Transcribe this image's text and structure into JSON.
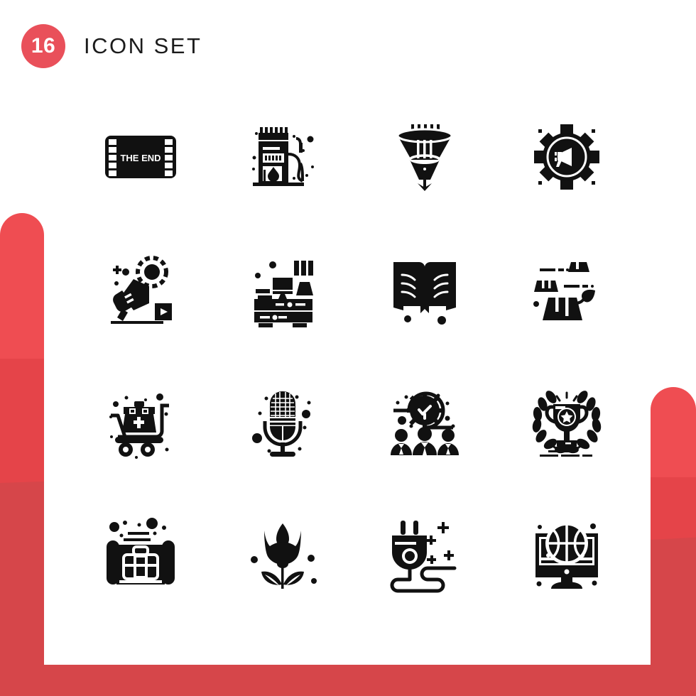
{
  "header": {
    "count": "16",
    "title": "Icon Set",
    "badge_color": "#e9505a",
    "title_color": "#1b1b1b"
  },
  "theme": {
    "background": "#ffffff",
    "accent": "#e9505a",
    "accent_light": "#ef4d52",
    "accent_mid": "#e54449",
    "accent_dark": "#d6464a",
    "icon_color": "#111111"
  },
  "grid": {
    "columns": 4,
    "rows": 4,
    "total": 16
  },
  "icons": [
    {
      "index": 1,
      "name": "film-strip-the-end-icon",
      "label": "Film Strip The End",
      "caption": "THE END",
      "row": 1,
      "col": 1
    },
    {
      "index": 2,
      "name": "fuel-pump-icon",
      "label": "Fuel Pump Station",
      "caption": "",
      "row": 1,
      "col": 2
    },
    {
      "index": 3,
      "name": "funnel-filter-icon",
      "label": "Funnel Filter",
      "caption": "",
      "row": 1,
      "col": 3
    },
    {
      "index": 4,
      "name": "gear-megaphone-icon",
      "label": "Marketing Settings",
      "caption": "",
      "row": 1,
      "col": 4
    },
    {
      "index": 5,
      "name": "megaphone-promotion-icon",
      "label": "Video Promotion",
      "caption": "",
      "row": 2,
      "col": 1
    },
    {
      "index": 6,
      "name": "office-desk-icon",
      "label": "Office Desk",
      "caption": "",
      "row": 2,
      "col": 2
    },
    {
      "index": 7,
      "name": "open-book-icon",
      "label": "Open Book",
      "caption": "",
      "row": 2,
      "col": 3
    },
    {
      "index": 8,
      "name": "tree-stump-leaf-icon",
      "label": "Deforestation",
      "caption": "",
      "row": 2,
      "col": 4
    },
    {
      "index": 9,
      "name": "shopping-cart-medical-kit-icon",
      "label": "Medical Kit Cart",
      "caption": "",
      "row": 3,
      "col": 1
    },
    {
      "index": 10,
      "name": "microphone-icon",
      "label": "Microphone",
      "caption": "",
      "row": 3,
      "col": 2
    },
    {
      "index": 11,
      "name": "team-time-management-icon",
      "label": "Team Time Management",
      "caption": "",
      "row": 3,
      "col": 3
    },
    {
      "index": 12,
      "name": "trophy-laurel-icon",
      "label": "Award Trophy",
      "caption": "",
      "row": 3,
      "col": 4
    },
    {
      "index": 13,
      "name": "blueprint-briefcase-icon",
      "label": "Business Plan",
      "caption": "",
      "row": 4,
      "col": 1
    },
    {
      "index": 14,
      "name": "tulip-flower-icon",
      "label": "Tulip Flower",
      "caption": "",
      "row": 4,
      "col": 2
    },
    {
      "index": 15,
      "name": "power-plug-icon",
      "label": "Power Plug",
      "caption": "",
      "row": 4,
      "col": 3
    },
    {
      "index": 16,
      "name": "monitor-basketball-icon",
      "label": "Sports Streaming",
      "caption": "",
      "row": 4,
      "col": 4
    }
  ]
}
